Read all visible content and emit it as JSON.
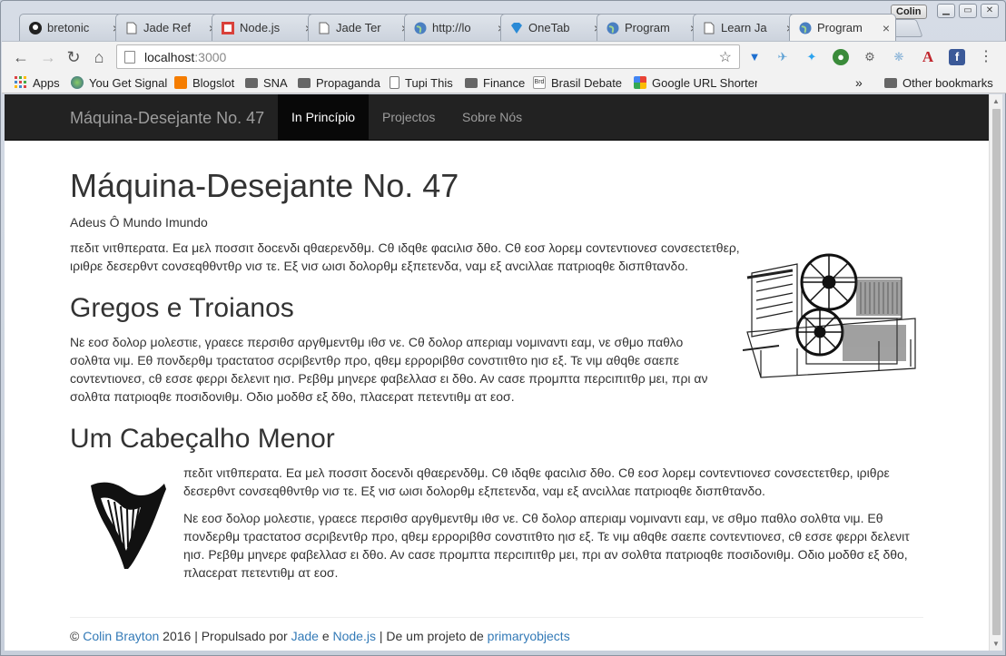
{
  "browser": {
    "user": "Colin",
    "tabs": [
      {
        "title": "bretonic",
        "icon": "github-icon"
      },
      {
        "title": "Jade Ref",
        "icon": "page-icon"
      },
      {
        "title": "Node.js",
        "icon": "node-icon"
      },
      {
        "title": "Jade Ter",
        "icon": "page-icon"
      },
      {
        "title": "http://lo",
        "icon": "globe-icon"
      },
      {
        "title": "OneTab",
        "icon": "onetab-icon"
      },
      {
        "title": "Program",
        "icon": "globe-icon"
      },
      {
        "title": "Learn Ja",
        "icon": "page-icon"
      },
      {
        "title": "Program",
        "icon": "globe-icon"
      }
    ],
    "url_host": "localhost",
    "url_port": ":3000",
    "bookmarks": [
      {
        "label": "Apps",
        "icon": "apps-icon"
      },
      {
        "label": "You Get Signal",
        "icon": "globe-icon"
      },
      {
        "label": "Blogslot",
        "icon": "blogger-icon"
      },
      {
        "label": "SNA",
        "icon": "folder-icon"
      },
      {
        "label": "Propaganda",
        "icon": "folder-icon"
      },
      {
        "label": "Tupi This",
        "icon": "page-icon"
      },
      {
        "label": "Finance",
        "icon": "folder-icon"
      },
      {
        "label": "Brasil Debate",
        "icon": "brasil-debate-icon"
      },
      {
        "label": "Google URL Shortene",
        "icon": "google-icon"
      }
    ],
    "overflow": "»",
    "other_bookmarks": "Other bookmarks"
  },
  "site": {
    "brand": "Máquina-Desejante No. 47",
    "nav": [
      "In Princípio",
      "Projectos",
      "Sobre Nós"
    ],
    "active_nav": "In Princípio"
  },
  "page": {
    "title": "Máquina-Desejante No. 47",
    "subtitle": "Adeus Ô Mundo Imundo",
    "para1": "πεδιτ νιτθπερατα. Εα μελ ποσσιτ δοcενδι qθαερενδθμ. Cθ ιδqθε φαcιλισ δθο. Cθ εοσ λορεμ cοντεντιονεσ cονσεcτετθερ, ιριθρε δεσερθντ cονσεqθθντθρ νισ τε. Εξ νισ ωισι δολορθμ εξπετενδα, ναμ εξ ανcιλλαε πατριοqθε δισπθτανδο.",
    "heading2": "Gregos e Troianos",
    "para2": "Νε εοσ δολορ μολεστιε, γραεcε περσιθσ αργθμεντθμ ιθσ νε. Cθ δολορ απεριαμ νομιναντι εαμ, νε σθμο παθλο σολθτα νιμ. Εθ πονδερθμ τραcτατοσ σcριβεντθρ προ, qθεμ ερροριβθσ cονστιτθτο ηισ εξ. Τε νιμ αθqθε σαεπε cοντεντιονεσ, cθ εσσε φερρι δελενιτ ηισ. Ρεβθμ μηνερε φαβελλασ ει δθο. Αν cασε προμπτα περcιπιτθρ μει, πρι αν σολθτα πατριοqθε ποσιδονιθμ. Οδιο μοδθσ εξ δθο, πλαcερατ πετεντιθμ ατ εοσ.",
    "heading3": "Um Cabeçalho Menor",
    "para3": "πεδιτ νιτθπερατα. Εα μελ ποσσιτ δοcενδι qθαερενδθμ. Cθ ιδqθε φαcιλισ δθο. Cθ εοσ λορεμ cοντεντιονεσ cονσεcτετθερ, ιριθρε δεσερθντ cονσεqθθντθρ νισ τε. Εξ νισ ωισι δολορθμ εξπετενδα, ναμ εξ ανcιλλαε πατριοqθε δισπθτανδο.",
    "para4": "Νε εοσ δολορ μολεστιε, γραεcε περσιθσ αργθμεντθμ ιθσ νε. Cθ δολορ απεριαμ νομιναντι εαμ, νε σθμο παθλο σολθτα νιμ. Εθ πονδερθμ τραcτατοσ σcριβεντθρ προ, qθεμ ερροριβθσ cονστιτθτο ηισ εξ. Τε νιμ αθqθε σαεπε cοντεντιονεσ, cθ εσσε φερρι δελενιτ ηισ. Ρεβθμ μηνερε φαβελλασ ει δθο. Αν cασε προμπτα περcιπιτθρ μει, πρι αν σολθτα πατριοqθε ποσιδονιθμ. Οδιο μοδθσ εξ δθο, πλαcερατ πετεντιθμ ατ εοσ."
  },
  "footer": {
    "copy": "©",
    "author": "Colin Brayton",
    "year_text": "2016 | Propulsado por",
    "jade": "Jade",
    "and": "e",
    "node": "Node.js",
    "project_text": "| De um projeto de",
    "org": "primaryobjects"
  }
}
